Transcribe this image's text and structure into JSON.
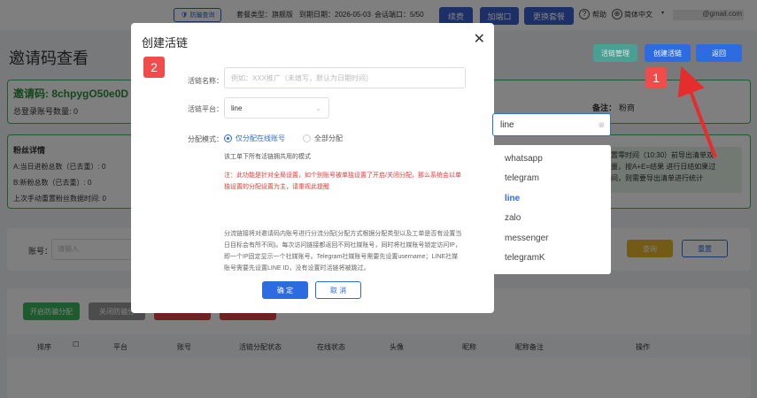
{
  "topbar": {
    "logo_label": "防骗查询",
    "plan_type": "套餐类型：旗舰版",
    "expire_date": "到期日期：2026-05-03",
    "ports": "会话端口：5/50",
    "renew_label": "续费",
    "add_port_label": "加端口",
    "change_plan_label": "更换套餐",
    "help_label": "帮助",
    "language": "简体中文",
    "email": "@gmail.com"
  },
  "page": {
    "title": "邀请码查看",
    "invite_code": "邀请码: 8chpygO50e0D",
    "total_accounts": "总登录账号数量: 0",
    "fans_title": "粉丝详情",
    "fans_total": "A:当日进粉总数（已去重）: 0",
    "fans_new": "B:新粉总数（已去重）: 0",
    "last_reset": "上次手动重置粉丝数据时间: 0",
    "remark": "备注：",
    "remark_value": "粉商",
    "notice_line1": "在置零时间（10:30）前导出清单双",
    "notice_line2": "数量，按A+E=结果 进行日结如果过",
    "notice_line3": "时间，则需要导出清单进行统计",
    "account_label": "账号：",
    "account_placeholder": "请输入",
    "query_label": "查询",
    "reset_label": "重置",
    "enable_protect": "开启防骗分配",
    "disable_protect": "关闭防骗分",
    "actions": {
      "manage_links": "活链管理",
      "create_link": "创建活链",
      "back": "返回"
    },
    "table_headers": [
      "排序",
      "平台",
      "账号",
      "活链分配状态",
      "在线状态",
      "头像",
      "昵称",
      "昵称备注",
      "操作"
    ]
  },
  "modal": {
    "title": "创建活链",
    "step_badge": "2",
    "name_label": "活链名称：",
    "name_placeholder": "例如：XXX推广（未填写，默认为日期时间）",
    "platform_label": "活链平台：",
    "platform_value": "line",
    "mode_label": "分配模式：",
    "mode_option_1": "仅分配在线账号",
    "mode_option_2": "全部分配",
    "note_1": "该工单下所有活链拥共用的模式",
    "note_warn_1": "注：此功能是针对全局设置，如个别账号被单独设置了开启/关闭分配，那么系统会以单",
    "note_warn_2": "独设置的分配设置为主，请重视此提醒",
    "desc_1": "分流链接将对邀请码内账号进行分流分配(分配方式根据分配类型以及工单是否有设置当",
    "desc_2": "日目标会有所不同)。每次访问链接都返回不同社媒账号，同时将社媒账号锁定访问IP，",
    "desc_3": "即一个IP固定显示一个社媒账号。Telegram社媒账号需要先设置username；LINE社媒",
    "desc_4": "账号需要先设置LINE ID，没有设置时活链将被跳过。",
    "confirm_label": "确 定",
    "cancel_label": "取 消"
  },
  "dropdown": {
    "search_value": "line",
    "options": [
      "whatsapp",
      "telegram",
      "line",
      "zalo",
      "messenger",
      "telegramK"
    ],
    "selected": "line"
  },
  "annotation": {
    "step1_badge": "1"
  },
  "colors": {
    "primary": "#2d6be0",
    "accent_red": "#f24b4b",
    "success_green": "#3bb55a"
  }
}
